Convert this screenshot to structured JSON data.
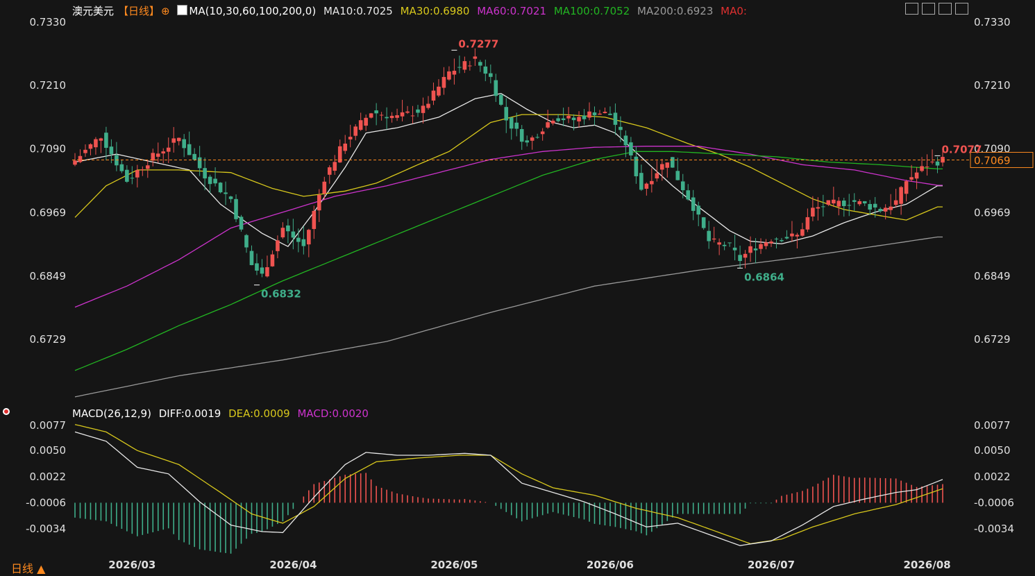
{
  "header": {
    "title": "澳元美元",
    "period_tag": "【日线】",
    "ma_params": "MA(10,30,60,100,200,0)",
    "ma10": "MA10:0.7025",
    "ma30": "MA30:0.6980",
    "ma60": "MA60:0.7021",
    "ma100": "MA100:0.7052",
    "ma200": "MA200:0.6923",
    "ma0": "MA0:"
  },
  "macd_header": {
    "params": "MACD(26,12,9)",
    "diff": "DIFF:0.0019",
    "dea": "DEA:0.0009",
    "macd": "MACD:0.0020"
  },
  "footer": {
    "period_label": "日线 ▲"
  },
  "colors": {
    "bg": "#151515",
    "up": "#ef5350",
    "down": "#3fae8a",
    "ma10": "#e8e8e8",
    "ma30": "#d8c81c",
    "ma60": "#cc33cc",
    "ma100": "#22b522",
    "ma200": "#9a9a9a",
    "ma0": "#e03030",
    "dea": "#d8c81c",
    "diff": "#e8e8e8",
    "accent": "#ff8a1f"
  },
  "toolbar_icons": [
    "grid-icon",
    "split-icon",
    "layout-icon",
    "export-icon"
  ],
  "chart_data": [
    {
      "type": "candlestick",
      "title": "澳元美元 日线",
      "yticks": [
        "0.7330",
        "0.7210",
        "0.7090",
        "0.6969",
        "0.6849",
        "0.6729"
      ],
      "ylim": [
        0.663,
        0.737
      ],
      "xticks": [
        {
          "label": "2026/03",
          "index": 11
        },
        {
          "label": "2026/04",
          "index": 42
        },
        {
          "label": "2026/05",
          "index": 73
        },
        {
          "label": "2026/06",
          "index": 103
        },
        {
          "label": "2026/07",
          "index": 134
        },
        {
          "label": "2026/08",
          "index": 164
        }
      ],
      "last_price": "0.7069",
      "annotations": [
        {
          "text": "0.7277",
          "index": 73,
          "value": 0.7277,
          "kind": "high"
        },
        {
          "text": "0.6832",
          "index": 35,
          "value": 0.6832,
          "kind": "low"
        },
        {
          "text": "0.6864",
          "index": 128,
          "value": 0.6864,
          "kind": "low"
        },
        {
          "text": "0.7077",
          "index": 166,
          "value": 0.7077,
          "kind": "high"
        }
      ],
      "anchors": [
        [
          0,
          0.7068
        ],
        [
          5,
          0.7115
        ],
        [
          10,
          0.703
        ],
        [
          15,
          0.7075
        ],
        [
          20,
          0.711
        ],
        [
          25,
          0.704
        ],
        [
          30,
          0.6995
        ],
        [
          34,
          0.687
        ],
        [
          36,
          0.685
        ],
        [
          40,
          0.694
        ],
        [
          44,
          0.6905
        ],
        [
          48,
          0.7035
        ],
        [
          52,
          0.7105
        ],
        [
          57,
          0.716
        ],
        [
          62,
          0.715
        ],
        [
          67,
          0.7165
        ],
        [
          72,
          0.7235
        ],
        [
          77,
          0.726
        ],
        [
          80,
          0.7225
        ],
        [
          83,
          0.7145
        ],
        [
          87,
          0.71
        ],
        [
          92,
          0.715
        ],
        [
          96,
          0.7145
        ],
        [
          100,
          0.716
        ],
        [
          103,
          0.7155
        ],
        [
          106,
          0.71
        ],
        [
          109,
          0.7015
        ],
        [
          114,
          0.707
        ],
        [
          119,
          0.698
        ],
        [
          122,
          0.6915
        ],
        [
          126,
          0.6905
        ],
        [
          128,
          0.688
        ],
        [
          130,
          0.69
        ],
        [
          134,
          0.692
        ],
        [
          139,
          0.6925
        ],
        [
          142,
          0.6975
        ],
        [
          145,
          0.6985
        ],
        [
          150,
          0.699
        ],
        [
          155,
          0.6975
        ],
        [
          158,
          0.699
        ],
        [
          160,
          0.703
        ],
        [
          164,
          0.706
        ],
        [
          167,
          0.7069
        ]
      ],
      "ma_series": [
        {
          "name": "MA10",
          "anchors": [
            [
              0,
              0.7065
            ],
            [
              8,
              0.708
            ],
            [
              15,
              0.7065
            ],
            [
              22,
              0.705
            ],
            [
              28,
              0.6985
            ],
            [
              36,
              0.693
            ],
            [
              41,
              0.6905
            ],
            [
              46,
              0.697
            ],
            [
              52,
              0.7055
            ],
            [
              56,
              0.712
            ],
            [
              62,
              0.713
            ],
            [
              70,
              0.715
            ],
            [
              77,
              0.7185
            ],
            [
              82,
              0.7195
            ],
            [
              87,
              0.7165
            ],
            [
              92,
              0.714
            ],
            [
              96,
              0.713
            ],
            [
              100,
              0.7135
            ],
            [
              104,
              0.712
            ],
            [
              110,
              0.7065
            ],
            [
              115,
              0.702
            ],
            [
              120,
              0.698
            ],
            [
              126,
              0.6935
            ],
            [
              130,
              0.6915
            ],
            [
              136,
              0.691
            ],
            [
              142,
              0.6925
            ],
            [
              148,
              0.695
            ],
            [
              154,
              0.697
            ],
            [
              160,
              0.6985
            ],
            [
              166,
              0.702
            ]
          ]
        },
        {
          "name": "MA30",
          "anchors": [
            [
              0,
              0.696
            ],
            [
              6,
              0.702
            ],
            [
              12,
              0.705
            ],
            [
              20,
              0.705
            ],
            [
              30,
              0.7045
            ],
            [
              38,
              0.7015
            ],
            [
              44,
              0.7
            ],
            [
              52,
              0.701
            ],
            [
              58,
              0.7025
            ],
            [
              66,
              0.706
            ],
            [
              72,
              0.7085
            ],
            [
              80,
              0.714
            ],
            [
              86,
              0.7155
            ],
            [
              94,
              0.7155
            ],
            [
              102,
              0.715
            ],
            [
              110,
              0.713
            ],
            [
              118,
              0.71
            ],
            [
              124,
              0.708
            ],
            [
              130,
              0.7055
            ],
            [
              136,
              0.7025
            ],
            [
              142,
              0.6995
            ],
            [
              148,
              0.6975
            ],
            [
              154,
              0.6965
            ],
            [
              160,
              0.6955
            ],
            [
              166,
              0.698
            ]
          ]
        },
        {
          "name": "MA60",
          "anchors": [
            [
              0,
              0.679
            ],
            [
              10,
              0.683
            ],
            [
              20,
              0.688
            ],
            [
              30,
              0.694
            ],
            [
              40,
              0.697
            ],
            [
              50,
              0.7
            ],
            [
              60,
              0.702
            ],
            [
              70,
              0.7045
            ],
            [
              80,
              0.707
            ],
            [
              90,
              0.7085
            ],
            [
              100,
              0.7093
            ],
            [
              110,
              0.7095
            ],
            [
              120,
              0.7095
            ],
            [
              130,
              0.708
            ],
            [
              140,
              0.706
            ],
            [
              150,
              0.705
            ],
            [
              160,
              0.703
            ],
            [
              166,
              0.7021
            ]
          ]
        },
        {
          "name": "MA100",
          "anchors": [
            [
              0,
              0.667
            ],
            [
              10,
              0.671
            ],
            [
              20,
              0.6755
            ],
            [
              30,
              0.6795
            ],
            [
              40,
              0.684
            ],
            [
              50,
              0.688
            ],
            [
              60,
              0.692
            ],
            [
              70,
              0.696
            ],
            [
              80,
              0.7
            ],
            [
              90,
              0.704
            ],
            [
              100,
              0.707
            ],
            [
              108,
              0.7085
            ],
            [
              115,
              0.7085
            ],
            [
              125,
              0.708
            ],
            [
              135,
              0.7075
            ],
            [
              145,
              0.7065
            ],
            [
              155,
              0.706
            ],
            [
              166,
              0.7052
            ]
          ]
        },
        {
          "name": "MA200",
          "anchors": [
            [
              0,
              0.662
            ],
            [
              20,
              0.666
            ],
            [
              40,
              0.669
            ],
            [
              60,
              0.6725
            ],
            [
              80,
              0.678
            ],
            [
              100,
              0.683
            ],
            [
              120,
              0.686
            ],
            [
              140,
              0.6885
            ],
            [
              166,
              0.6923
            ]
          ]
        }
      ]
    },
    {
      "type": "macd",
      "title": "MACD(26,12,9)",
      "yticks": [
        "0.0077",
        "0.0050",
        "0.0022",
        "-0.0006",
        "-0.0034"
      ],
      "ylim": [
        -0.006,
        0.0095
      ],
      "series": [
        {
          "name": "DIFF",
          "anchors": [
            [
              0,
              0.007
            ],
            [
              6,
              0.006
            ],
            [
              12,
              0.0032
            ],
            [
              18,
              0.0025
            ],
            [
              24,
              -0.0005
            ],
            [
              30,
              -0.003
            ],
            [
              36,
              -0.0037
            ],
            [
              40,
              -0.0038
            ],
            [
              46,
              0.0
            ],
            [
              52,
              0.0035
            ],
            [
              56,
              0.0048
            ],
            [
              62,
              0.0045
            ],
            [
              68,
              0.0045
            ],
            [
              75,
              0.0047
            ],
            [
              80,
              0.0045
            ],
            [
              86,
              0.0015
            ],
            [
              92,
              0.0005
            ],
            [
              98,
              -0.0005
            ],
            [
              104,
              -0.0018
            ],
            [
              110,
              -0.0032
            ],
            [
              116,
              -0.0028
            ],
            [
              122,
              -0.004
            ],
            [
              128,
              -0.0052
            ],
            [
              134,
              -0.0047
            ],
            [
              140,
              -0.003
            ],
            [
              146,
              -0.001
            ],
            [
              152,
              -0.0002
            ],
            [
              158,
              0.0005
            ],
            [
              162,
              0.0008
            ],
            [
              167,
              0.0019
            ]
          ]
        },
        {
          "name": "DEA",
          "anchors": [
            [
              0,
              0.0078
            ],
            [
              6,
              0.007
            ],
            [
              12,
              0.005
            ],
            [
              20,
              0.0035
            ],
            [
              28,
              0.0005
            ],
            [
              34,
              -0.0018
            ],
            [
              40,
              -0.0028
            ],
            [
              46,
              -0.001
            ],
            [
              52,
              0.002
            ],
            [
              58,
              0.0038
            ],
            [
              66,
              0.0042
            ],
            [
              74,
              0.0045
            ],
            [
              80,
              0.0045
            ],
            [
              86,
              0.0025
            ],
            [
              92,
              0.001
            ],
            [
              100,
              0.0002
            ],
            [
              108,
              -0.0012
            ],
            [
              116,
              -0.0022
            ],
            [
              124,
              -0.0038
            ],
            [
              130,
              -0.005
            ],
            [
              136,
              -0.0045
            ],
            [
              142,
              -0.0032
            ],
            [
              150,
              -0.0018
            ],
            [
              158,
              -0.0008
            ],
            [
              167,
              0.0009
            ]
          ]
        }
      ],
      "histogram": "2 × (DIFF − DEA)"
    }
  ]
}
